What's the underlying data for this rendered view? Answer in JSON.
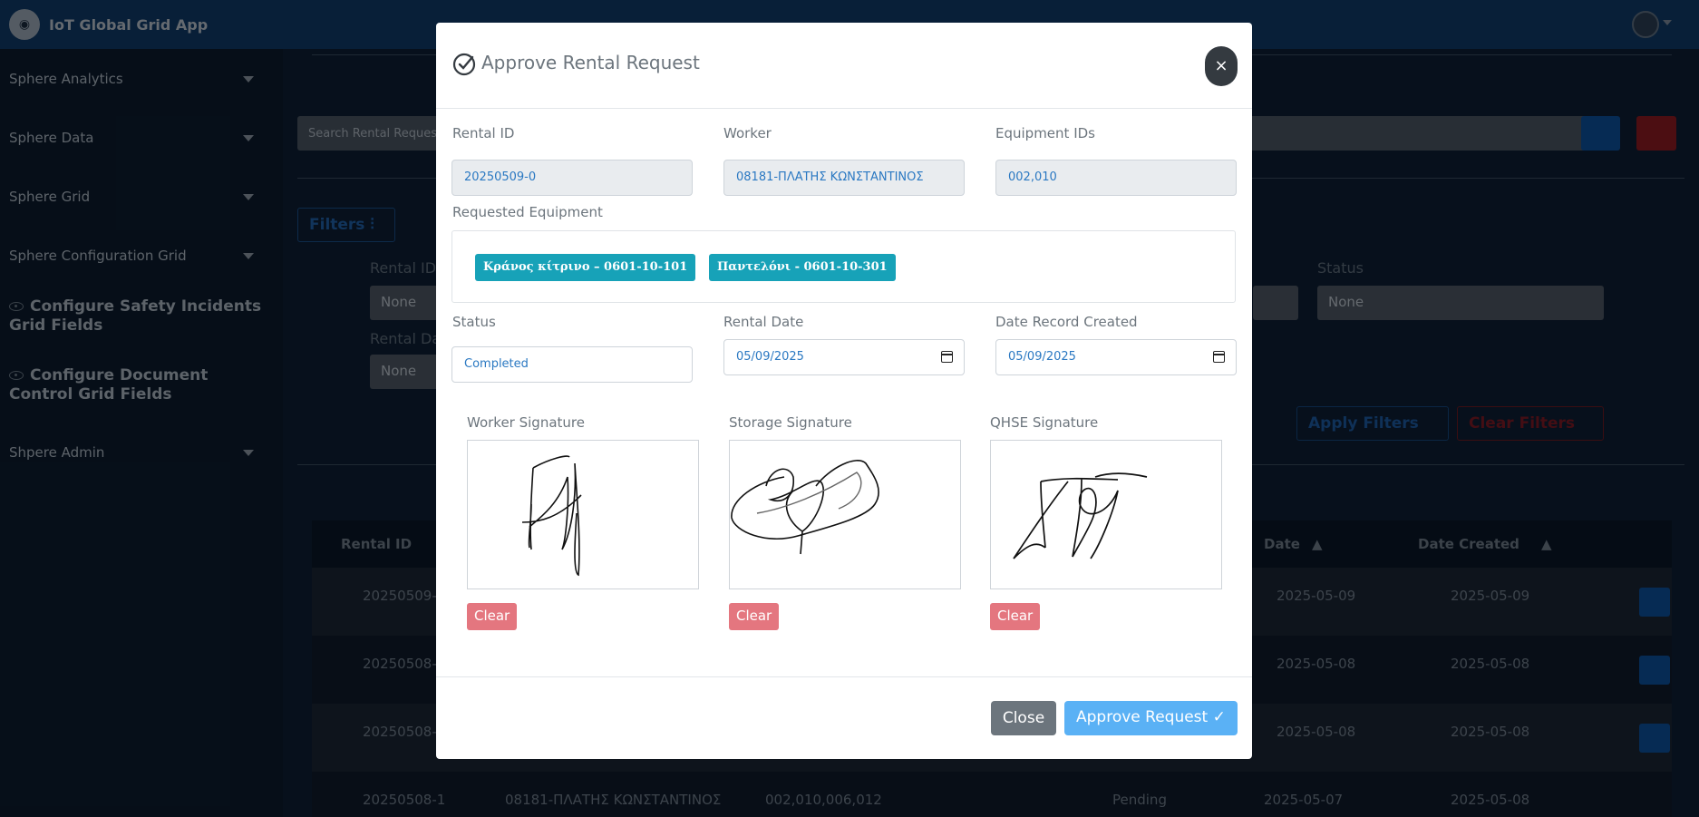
{
  "app": {
    "title": "IoT Global Grid App"
  },
  "sidebar": {
    "items": [
      {
        "label": "Sphere Analytics"
      },
      {
        "label": "Sphere Data"
      },
      {
        "label": "Sphere Grid"
      },
      {
        "label": "Sphere Configuration Grid"
      },
      {
        "label": "Configure Safety Incidents Grid Fields"
      },
      {
        "label": "Configure Document Control Grid Fields"
      },
      {
        "label": "Shpere Admin"
      }
    ]
  },
  "background": {
    "search_placeholder": "Search Rental Requests",
    "filters_label": "Filters",
    "filter_rental_id_label": "Rental ID",
    "filter_rental_id_value": "None",
    "filter_rental_date_label": "Rental Date",
    "filter_rental_date_value": "None",
    "filter_status_label": "Status",
    "filter_status_value": "None",
    "apply_filters": "Apply Filters",
    "clear_filters": "Clear Filters",
    "table": {
      "headers": [
        "Rental ID",
        "Date",
        "Date Created"
      ],
      "sort_glyph": "▲",
      "rows": [
        {
          "rental_id": "20250509-",
          "date": "2025-05-09",
          "created": "2025-05-09"
        },
        {
          "rental_id": "20250508-",
          "date": "2025-05-08",
          "created": "2025-05-08"
        },
        {
          "rental_id": "20250508-",
          "date": "2025-05-08",
          "created": "2025-05-08"
        },
        {
          "rental_id": "20250508-1",
          "worker": "08181-ΠΛΑΤΗΣ ΚΩΝΣΤΑΝΤΙΝΟΣ",
          "equipment": "002,010,006,012",
          "status": "Pending",
          "date": "2025-05-07",
          "created": "2025-05-08"
        }
      ]
    }
  },
  "modal": {
    "title": "Approve Rental Request",
    "close_symbol": "×",
    "fields": {
      "rental_id_label": "Rental ID",
      "rental_id_value": "20250509-0",
      "worker_label": "Worker",
      "worker_value": "08181-ΠΛΑΤΗΣ ΚΩΝΣΤΑΝΤΙΝΟΣ",
      "equipment_ids_label": "Equipment IDs",
      "equipment_ids_value": "002,010",
      "requested_equipment_label": "Requested Equipment",
      "requested_equipment": [
        "Κράνος κίτρινο – 0601-10-101",
        "Παντελόνι - 0601-10-301"
      ],
      "status_label": "Status",
      "status_value": "Completed",
      "rental_date_label": "Rental Date",
      "rental_date_value": "05/09/2025",
      "date_created_label": "Date Record Created",
      "date_created_value": "05/09/2025"
    },
    "signatures": {
      "worker_label": "Worker Signature",
      "storage_label": "Storage Signature",
      "qhse_label": "QHSE Signature",
      "clear_label": "Clear"
    },
    "footer": {
      "close_label": "Close",
      "approve_label": "Approve Request ✓"
    }
  },
  "colors": {
    "topbar": "#0f3a66",
    "badge": "#17a2b8",
    "approve": "#5ab1f5",
    "clear": "#e4767f",
    "close": "#6c757d"
  }
}
